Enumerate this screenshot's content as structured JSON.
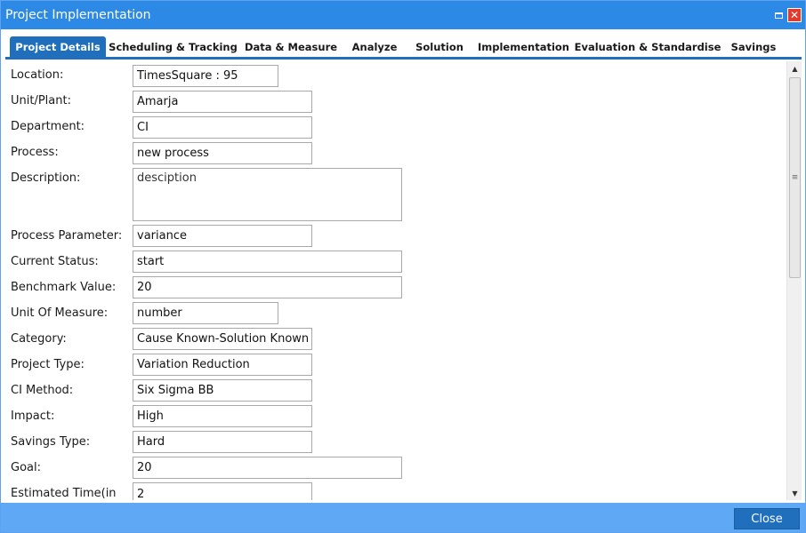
{
  "window": {
    "title": "Project Implementation",
    "restore_icon": "restore-window-icon",
    "close_glyph": "✕",
    "title_color": "#2d89e6"
  },
  "tabs": [
    {
      "label": "Project Details",
      "active": true
    },
    {
      "label": "Scheduling & Tracking",
      "active": false
    },
    {
      "label": "Data & Measure",
      "active": false
    },
    {
      "label": "Analyze",
      "active": false
    },
    {
      "label": "Solution",
      "active": false
    },
    {
      "label": "Implementation",
      "active": false
    },
    {
      "label": "Evaluation & Standardise",
      "active": false
    },
    {
      "label": "Savings",
      "active": false
    }
  ],
  "form": {
    "location": {
      "label": "Location:",
      "value": "TimesSquare : 95"
    },
    "unit_plant": {
      "label": "Unit/Plant:",
      "value": "Amarja"
    },
    "department": {
      "label": "Department:",
      "value": "CI"
    },
    "process": {
      "label": "Process:",
      "value": "new process"
    },
    "description": {
      "label": "Description:",
      "value": "desciption"
    },
    "process_parameter": {
      "label": "Process Parameter:",
      "value": "variance"
    },
    "current_status": {
      "label": "Current Status:",
      "value": "start"
    },
    "benchmark_value": {
      "label": "Benchmark Value:",
      "value": "20"
    },
    "unit_of_measure": {
      "label": "Unit Of Measure:",
      "value": "number"
    },
    "category": {
      "label": "Category:",
      "value": "Cause Known-Solution Known"
    },
    "project_type": {
      "label": "Project Type:",
      "value": "Variation Reduction"
    },
    "ci_method": {
      "label": "CI Method:",
      "value": "Six Sigma BB"
    },
    "impact": {
      "label": "Impact:",
      "value": "High"
    },
    "savings_type": {
      "label": "Savings Type:",
      "value": "Hard"
    },
    "goal": {
      "label": "Goal:",
      "value": "20"
    },
    "estimated_time": {
      "label": "Estimated Time(in",
      "value": "2"
    }
  },
  "scrollbar": {
    "up_glyph": "▲",
    "down_glyph": "▼",
    "grip_glyph": "≡"
  },
  "footer": {
    "close_label": "Close"
  },
  "colors": {
    "accent": "#1f6fbd",
    "titlebar": "#2d89e6",
    "footer": "#5fa8f5",
    "close_button_x": "#e23b2e"
  }
}
